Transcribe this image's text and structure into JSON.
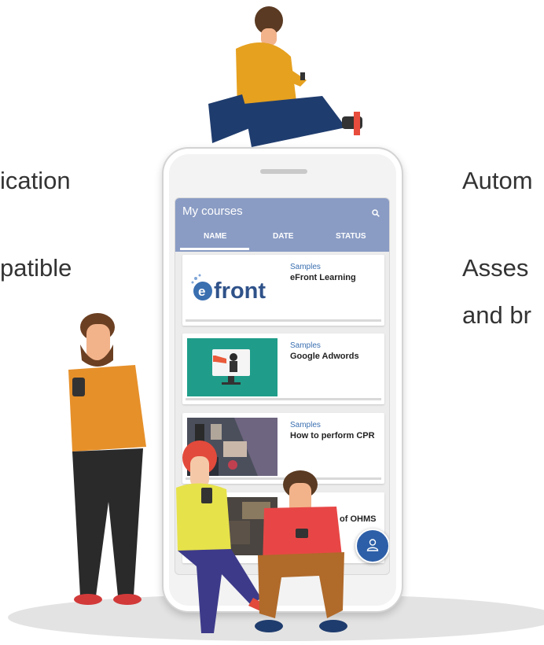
{
  "left_texts": [
    "ication",
    "patible"
  ],
  "right_texts": [
    "Autom",
    "Asses",
    "and br"
  ],
  "app": {
    "title": "My courses",
    "tabs": [
      "NAME",
      "DATE",
      "STATUS"
    ],
    "logo_text": "front"
  },
  "courses": [
    {
      "category": "Samples",
      "title": "eFront Learning"
    },
    {
      "category": "Samples",
      "title": "Google Adwords"
    },
    {
      "category": "Samples",
      "title": "How to perform CPR"
    },
    {
      "category": "",
      "title": "of OHMS"
    }
  ],
  "colors": {
    "header": "#8a9cc4",
    "fab": "#2d5fa8",
    "link": "#3a6fb0"
  },
  "icons": [
    "search-icon",
    "user-icon"
  ]
}
